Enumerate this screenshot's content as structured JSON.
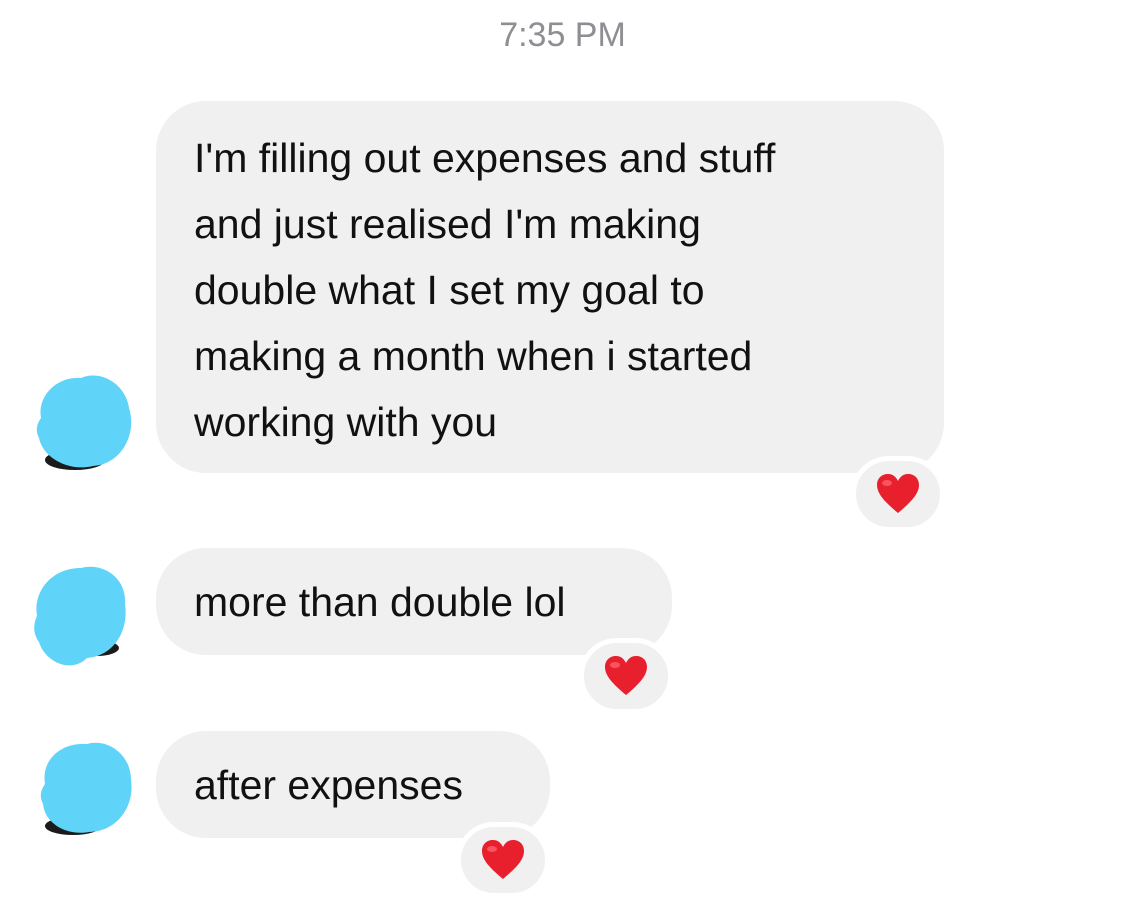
{
  "timestamp": "7:35 PM",
  "colors": {
    "bubble": "#f0f0f1",
    "avatar_redaction": "#5fd3f8",
    "heart": "#e8202d",
    "timestamp": "#8e8e93"
  },
  "messages": [
    {
      "text": "I'm filling out expenses and stuff\nand just realised I'm making\ndouble what I set my goal to\nmaking a month when i started\nworking with you",
      "reaction": "red-heart-icon"
    },
    {
      "text": "more than double lol",
      "reaction": "red-heart-icon"
    },
    {
      "text": "after expenses",
      "reaction": "red-heart-icon"
    }
  ]
}
